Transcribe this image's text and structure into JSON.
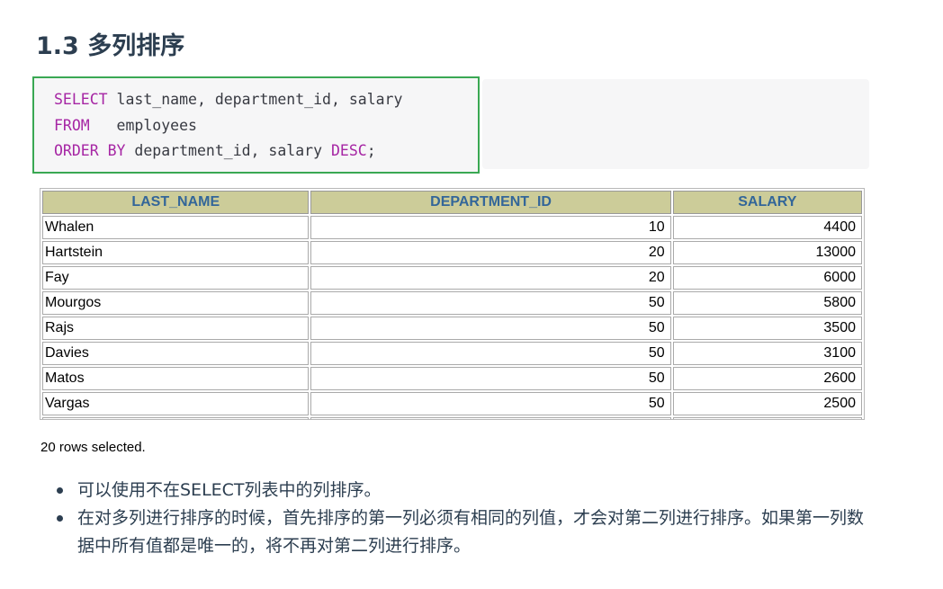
{
  "heading": "1.3 多列排序",
  "code": {
    "line1_kw": "SELECT",
    "line1_rest": " last_name, department_id, salary",
    "line2_kw": "FROM",
    "line2_rest": "   employees",
    "line3_kw1": "ORDER BY",
    "line3_mid": " department_id, salary ",
    "line3_kw2": "DESC",
    "line3_end": ";"
  },
  "table": {
    "headers": [
      "LAST_NAME",
      "DEPARTMENT_ID",
      "SALARY"
    ],
    "rows": [
      [
        "Whalen",
        "10",
        "4400"
      ],
      [
        "Hartstein",
        "20",
        "13000"
      ],
      [
        "Fay",
        "20",
        "6000"
      ],
      [
        "Mourgos",
        "50",
        "5800"
      ],
      [
        "Rajs",
        "50",
        "3500"
      ],
      [
        "Davies",
        "50",
        "3100"
      ],
      [
        "Matos",
        "50",
        "2600"
      ],
      [
        "Vargas",
        "50",
        "2500"
      ],
      [
        "",
        "",
        ""
      ]
    ]
  },
  "rows_selected": "20 rows selected.",
  "bullets": [
    "可以使用不在SELECT列表中的列排序。",
    "在对多列进行排序的时候，首先排序的第一列必须有相同的列值，才会对第二列进行排序。如果第一列数据中所有值都是唯一的，将不再对第二列进行排序。"
  ],
  "colors": {
    "code_border": "#3aa853",
    "keyword": "#a626a4",
    "table_header_bg": "#cccc99",
    "table_header_text": "#336699"
  }
}
